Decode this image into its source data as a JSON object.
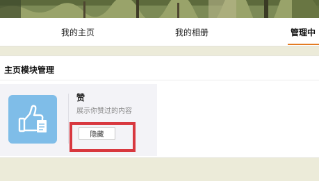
{
  "nav": {
    "tabs": [
      {
        "label": "我的主页"
      },
      {
        "label": "我的相册"
      },
      {
        "label": "管理中"
      }
    ],
    "active_tab": "管理中",
    "accent_color": "#e37b22"
  },
  "module_panel": {
    "title": "主页模块管理"
  },
  "module_card": {
    "icon": "thumbs-up-icon",
    "icon_bg": "#7fbde8",
    "title": "赞",
    "description": "展示你赞过的内容",
    "button_label": "隐藏"
  },
  "highlight_color": "#d8383f"
}
